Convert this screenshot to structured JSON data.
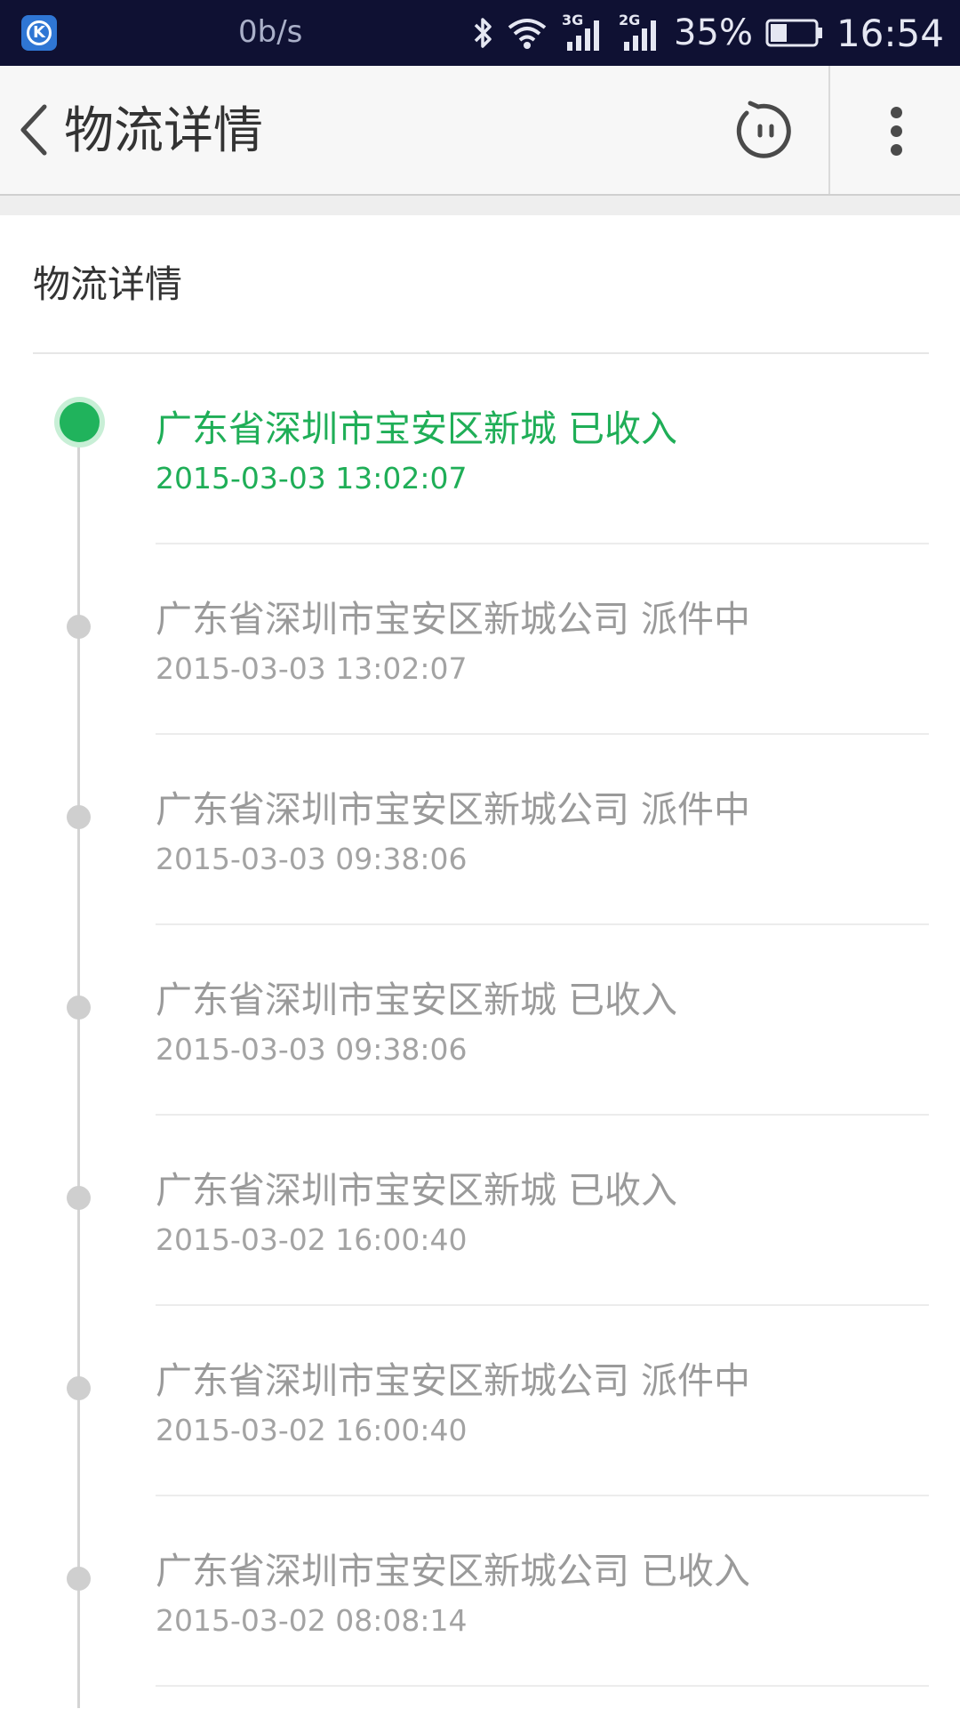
{
  "status_bar": {
    "speed": "0b/s",
    "network_3g": "3G",
    "network_2g": "2G",
    "battery": "35%",
    "time": "16:54",
    "app_icon_letter": "K"
  },
  "app_bar": {
    "title": "物流详情",
    "back_icon": "chevron-left-icon",
    "robot_icon": "robot-face-icon",
    "more_icon": "more-vertical-icon"
  },
  "section": {
    "title": "物流详情"
  },
  "timeline": {
    "entries": [
      {
        "text": "广东省深圳市宝安区新城 已收入",
        "time": "2015-03-03 13:02:07",
        "active": true
      },
      {
        "text": "广东省深圳市宝安区新城公司 派件中",
        "time": "2015-03-03 13:02:07",
        "active": false
      },
      {
        "text": "广东省深圳市宝安区新城公司 派件中",
        "time": "2015-03-03 09:38:06",
        "active": false
      },
      {
        "text": "广东省深圳市宝安区新城 已收入",
        "time": "2015-03-03 09:38:06",
        "active": false
      },
      {
        "text": "广东省深圳市宝安区新城 已收入",
        "time": "2015-03-02 16:00:40",
        "active": false
      },
      {
        "text": "广东省深圳市宝安区新城公司 派件中",
        "time": "2015-03-02 16:00:40",
        "active": false
      },
      {
        "text": "广东省深圳市宝安区新城公司 已收入",
        "time": "2015-03-02 08:08:14",
        "active": false
      }
    ]
  },
  "colors": {
    "active_green": "#1fae57",
    "status_bar_bg": "#0f1133",
    "inactive_text": "#9a9a9a"
  }
}
